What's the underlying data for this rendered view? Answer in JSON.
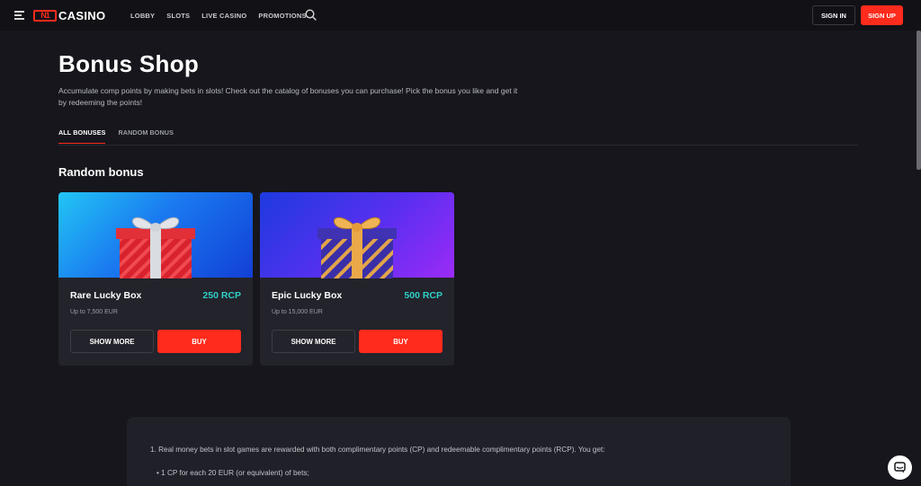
{
  "header": {
    "logo_mark": "N1",
    "logo_text": "CASINO",
    "nav": [
      "LOBBY",
      "SLOTS",
      "LIVE CASINO",
      "PROMOTIONS"
    ],
    "signin_label": "SIGN IN",
    "signup_label": "SIGN UP",
    "icons": {
      "menu": "menu-icon",
      "search": "search-icon"
    }
  },
  "page": {
    "title": "Bonus Shop",
    "description": "Accumulate comp points by making bets in slots! Check out the catalog of bonuses you can purchase! Pick the bonus you like and get it by redeeming the points!"
  },
  "tabs": [
    {
      "label": "ALL BONUSES",
      "active": true
    },
    {
      "label": "RANDOM BONUS",
      "active": false
    }
  ],
  "section": {
    "title": "Random bonus"
  },
  "cards": [
    {
      "name": "Rare Lucky Box",
      "price": "250 RCP",
      "limit": "Up to 7,500 EUR",
      "more_label": "SHOW MORE",
      "buy_label": "BUY"
    },
    {
      "name": "Epic Lucky Box",
      "price": "500 RCP",
      "limit": "Up to 15,000 EUR",
      "more_label": "SHOW MORE",
      "buy_label": "BUY"
    }
  ],
  "info": {
    "line1": "1. Real money bets in slot games are rewarded with both complimentary points (CP) and redeemable complimentary points (RCP). You get:",
    "line2": "• 1 CP for each 20 EUR (or equivalent) of bets;"
  },
  "colors": {
    "accent": "#ff2b1c",
    "price": "#2fd0c8",
    "background": "#16161c",
    "card": "#23232b"
  }
}
